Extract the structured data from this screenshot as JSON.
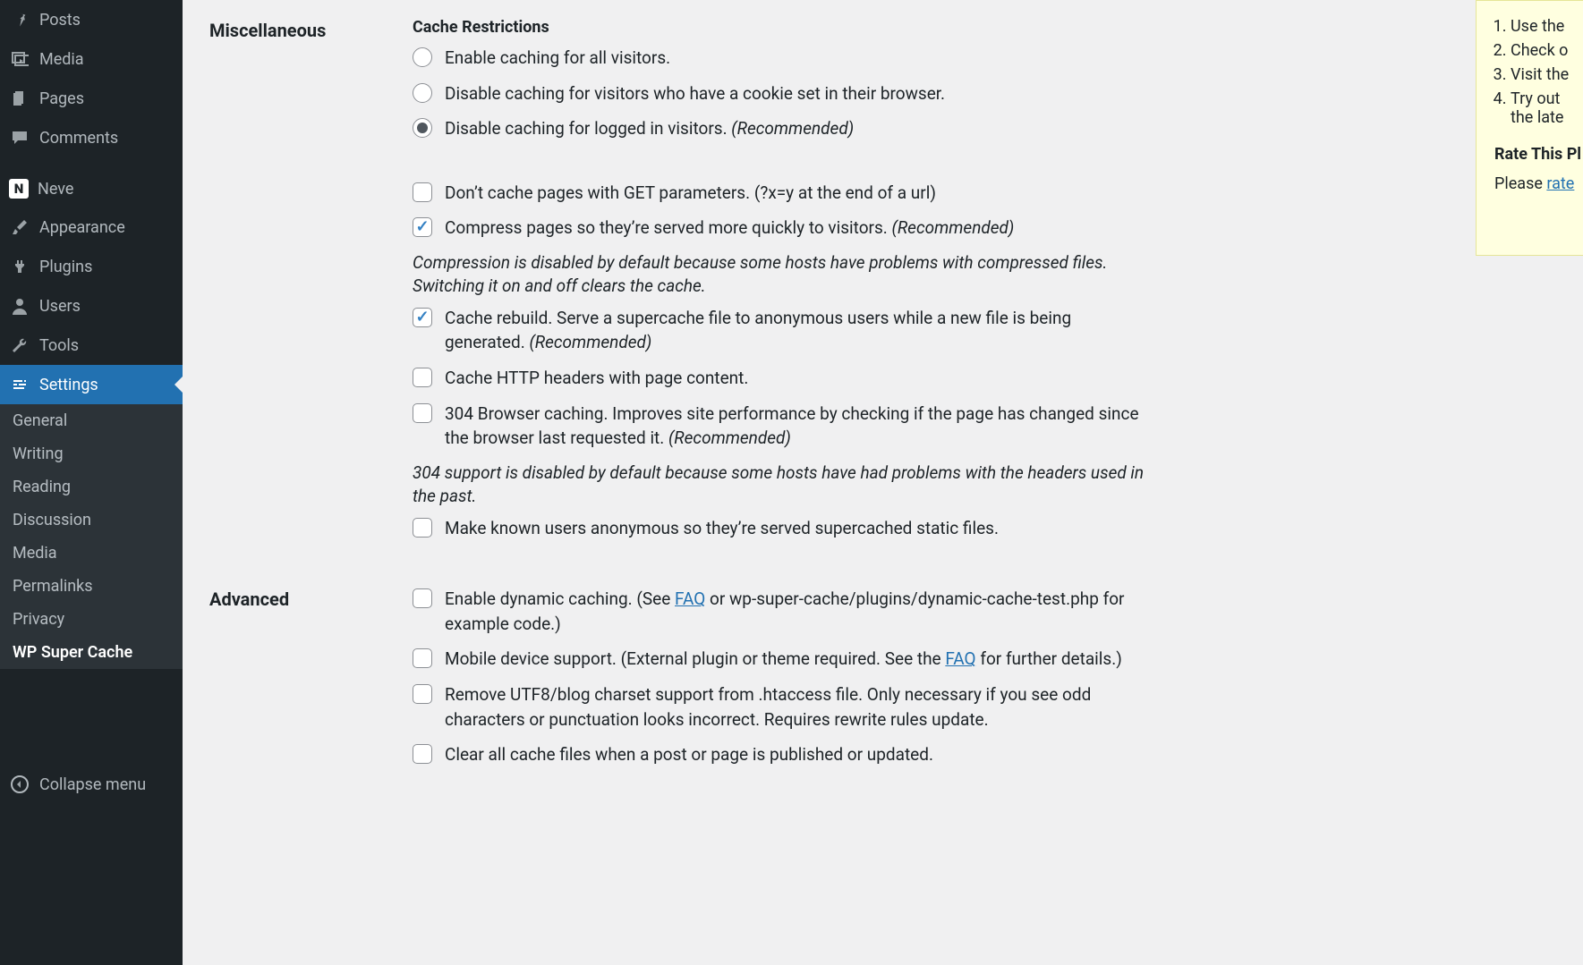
{
  "sidebar": {
    "items": [
      {
        "id": "posts",
        "label": "Posts"
      },
      {
        "id": "media",
        "label": "Media"
      },
      {
        "id": "pages",
        "label": "Pages"
      },
      {
        "id": "comments",
        "label": "Comments"
      },
      {
        "id": "neve",
        "label": "Neve"
      },
      {
        "id": "appearance",
        "label": "Appearance"
      },
      {
        "id": "plugins",
        "label": "Plugins"
      },
      {
        "id": "users",
        "label": "Users"
      },
      {
        "id": "tools",
        "label": "Tools"
      },
      {
        "id": "settings",
        "label": "Settings"
      }
    ],
    "submenu": [
      "General",
      "Writing",
      "Reading",
      "Discussion",
      "Media",
      "Permalinks",
      "Privacy",
      "WP Super Cache"
    ],
    "collapse_label": "Collapse menu"
  },
  "sections": {
    "misc_label": "Miscellaneous",
    "advanced_label": "Advanced",
    "cache_restrictions_heading": "Cache Restrictions"
  },
  "opts": {
    "r_all": "Enable caching for all visitors.",
    "r_cookie": "Disable caching for visitors who have a cookie set in their browser.",
    "r_logged_pre": "Disable caching for logged in visitors. ",
    "rec": "(Recommended)",
    "cb_get": "Don’t cache pages with GET parameters. (?x=y at the end of a url)",
    "cb_compress_pre": "Compress pages so they’re served more quickly to visitors. ",
    "note_compress": "Compression is disabled by default because some hosts have problems with compressed files. Switching it on and off clears the cache.",
    "cb_rebuild_pre": "Cache rebuild. Serve a supercache file to anonymous users while a new file is being generated. ",
    "cb_headers": "Cache HTTP headers with page content.",
    "cb_304_pre": "304 Browser caching. Improves site performance by checking if the page has changed since the browser last requested it. ",
    "note_304": "304 support is disabled by default because some hosts have had problems with the headers used in the past.",
    "cb_anon": "Make known users anonymous so they’re served supercached static files.",
    "adv_dynamic_pre": "Enable dynamic caching. (See ",
    "adv_dynamic_post": " or wp-super-cache/plugins/dynamic-cache-test.php for example code.)",
    "adv_mobile_pre": "Mobile device support. (External plugin or theme required. See the ",
    "adv_mobile_post": " for further details.)",
    "adv_utf8": "Remove UTF8/blog charset support from .htaccess file. Only necessary if you see odd characters or punctuation looks incorrect. Requires rewrite rules update.",
    "adv_clear": "Clear all cache files when a post or page is published or updated.",
    "faq": "FAQ"
  },
  "rightbox": {
    "items": [
      "Use the",
      "Check o",
      "Visit the",
      "Try out ",
      "the late"
    ],
    "heading": "Rate This Pl",
    "please": "Please ",
    "rate_link": "rate "
  }
}
